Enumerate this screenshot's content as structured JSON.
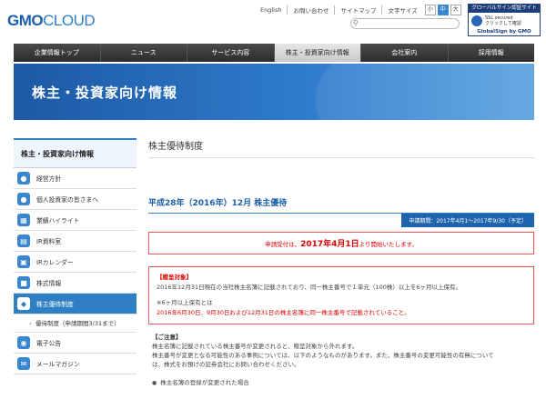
{
  "header": {
    "logo_gmo": "GMO",
    "logo_cloud": "CLOUD",
    "links": [
      "English",
      "お問い合わせ",
      "サイトマップ"
    ],
    "font_size_label": "文字サイズ",
    "font_sizes": [
      "小",
      "中",
      "大"
    ],
    "badge_top": "グローバルサイン認証サイト",
    "badge_line1": "SSL secured",
    "badge_line2": "クリックして確認",
    "badge_bottom": "GlobalSign by GMO"
  },
  "nav": [
    "企業情報トップ",
    "ニュース",
    "サービス内容",
    "株主・投資家向け情報",
    "会社案内",
    "採用情報"
  ],
  "banner": {
    "title": "株主・投資家向け情報"
  },
  "sidebar": {
    "heading": "株主・投資家向け情報",
    "items": [
      {
        "label": "経営方針",
        "icon": "person-icon",
        "color": "#3a86d0"
      },
      {
        "label": "個人投資家の皆さまへ",
        "icon": "people-icon",
        "color": "#3a86d0"
      },
      {
        "label": "業績ハイライト",
        "icon": "chart-icon",
        "color": "#3a86d0"
      },
      {
        "label": "IR資料室",
        "icon": "document-icon",
        "color": "#3a86d0"
      },
      {
        "label": "IRカレンダー",
        "icon": "calendar-icon",
        "color": "#3a86d0"
      },
      {
        "label": "株式情報",
        "icon": "stock-icon",
        "color": "#3a86d0"
      },
      {
        "label": "株主優待制度",
        "icon": "gift-icon",
        "color": "#3a86d0"
      }
    ],
    "sub_item": "優待制度（申請期間3/31まで）",
    "items2": [
      {
        "label": "電子公告",
        "icon": "notice-icon",
        "color": "#3a86d0"
      },
      {
        "label": "メールマガジン",
        "icon": "mail-icon",
        "color": "#3a86d0"
      }
    ]
  },
  "main": {
    "page_title": "株主優待制度",
    "section_title": "平成28年（2016年）12月 株主優待",
    "period": "申請期間：2017年4月1〜2017年9/30（予定）",
    "notice_pre": "申請受付は、",
    "notice_date": "2017年4月1日",
    "notice_post": "より開始いたします。",
    "eligible_label": "【贈呈対象】",
    "eligible_text": "2016年12月31日現在の当社株主名簿に記載されており、同一株主番号で１単元（100株）以上を6ヶ月以上保有。",
    "six_months_label": "※6ヶ月以上保有とは",
    "six_months_text": "2016年6月30日、9月30日および12月31日の株主名簿に同一株主番号で記載されていること。",
    "caution_label": "【ご注意】",
    "caution_lines": [
      "株主名簿に記載されている株主番号が変更されると、贈呈対象から外れます。",
      "株主番号が変更となる可能性のある事例については、以下のようなものがあります。また、株主番号の変更可能性の有無について",
      "は、株式をお預けの証券会社にお問い合わせください。"
    ],
    "bullet": "株主名簿の登録が変更された場合"
  },
  "colors": {
    "accent": "#2f7fc4",
    "nav_bg": "#2c2c2c",
    "alert": "#dd0000"
  }
}
